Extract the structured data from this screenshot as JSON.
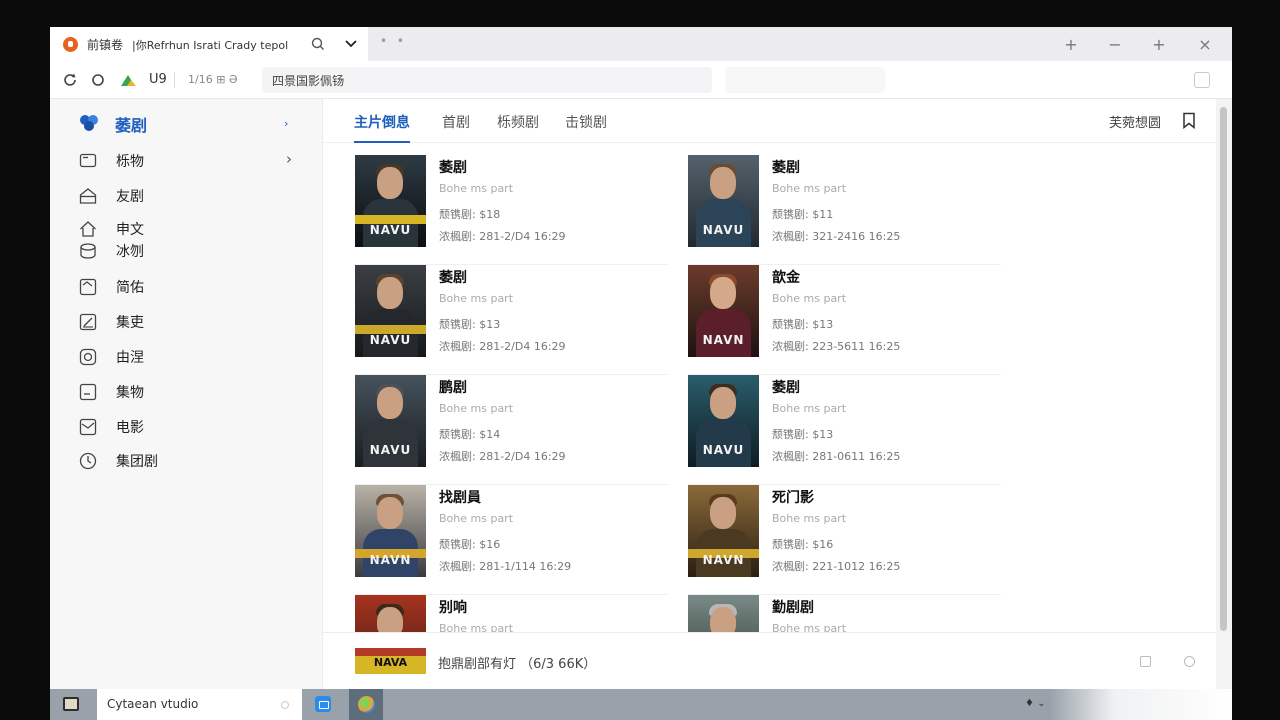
{
  "window": {
    "tab": {
      "title": "前镇卷",
      "subtitle": "|你Refrhun Israti  Crady tepol"
    },
    "controls": {
      "minimize_alt": "+",
      "minimize": "−",
      "maximize": "+",
      "close": "×"
    }
  },
  "addressbar": {
    "page_num": "U9",
    "zoom_text": "1/16  ⊞  Ə",
    "url": "四景国影佩钖"
  },
  "sidebar": {
    "header": {
      "label": "萎剧"
    },
    "items": [
      {
        "label": "栎物",
        "icon": "tv-icon",
        "has_chevron": true
      },
      {
        "label": "友剧",
        "icon": "house-icon"
      },
      {
        "label": "申文",
        "icon": "home-icon"
      },
      {
        "label": "冰刎",
        "icon": "cylinder-icon"
      },
      {
        "label": "简佑",
        "icon": "image-icon"
      },
      {
        "label": "集吏",
        "icon": "edit-icon"
      },
      {
        "label": "由涅",
        "icon": "camera-icon"
      },
      {
        "label": "集物",
        "icon": "minus-box-icon"
      },
      {
        "label": "电影",
        "icon": "picture-icon"
      },
      {
        "label": "集团剧",
        "icon": "clock-icon"
      }
    ]
  },
  "main": {
    "tabs": [
      {
        "label": "主片倒息",
        "active": true
      },
      {
        "label": "首剧"
      },
      {
        "label": "栎频剧"
      },
      {
        "label": "击锁剧"
      }
    ],
    "right_link": "芙菀想圆",
    "cards": [
      {
        "title": "萎剧",
        "sub": "Bohe ms part",
        "price": "颓镌剧: $18",
        "date": "浓楓剧: 281-2/D4 16:29",
        "poster_text": "NAVU"
      },
      {
        "title": "萎剧",
        "sub": "Bohe ms part",
        "price": "颓镌剧: $11",
        "date": "浓楓剧: 321-2416 16:25",
        "poster_text": "NAVU"
      },
      {
        "title": "萎剧",
        "sub": "Bohe ms part",
        "price": "颓镌剧: $13",
        "date": "浓楓剧: 281-2/D4 16:29",
        "poster_text": "NAVU"
      },
      {
        "title": "歆金",
        "sub": "Bohe ms part",
        "price": "颓镌剧: $13",
        "date": "浓楓剧: 223-5611 16:25",
        "poster_text": "NAVN"
      },
      {
        "title": "鹏剧",
        "sub": "Bohe ms part",
        "price": "颓镌剧: $14",
        "date": "浓楓剧: 281-2/D4 16:29",
        "poster_text": "NAVU"
      },
      {
        "title": "萎剧",
        "sub": "Bohe ms part",
        "price": "颓镌剧: $13",
        "date": "浓楓剧: 281-0611 16:25",
        "poster_text": "NAVU"
      },
      {
        "title": "找剧員",
        "sub": "Bohe ms part",
        "price": "颓镌剧: $16",
        "date": "浓楓剧: 281-1/114 16:29",
        "poster_text": "NAVN"
      },
      {
        "title": "死门影",
        "sub": "Bohe ms part",
        "price": "颓镌剧: $16",
        "date": "浓楓剧: 221-1012 16:25",
        "poster_text": "NAVN"
      },
      {
        "title": "别响",
        "sub": "Bohe ms part",
        "price": "",
        "date": "",
        "poster_text": ""
      },
      {
        "title": "勤剧剧",
        "sub": "Bohe ms part",
        "price": "",
        "date": "",
        "poster_text": ""
      }
    ]
  },
  "player": {
    "thumb_text": "NAVA",
    "text": "抱鼎剧部有灯  （6/3 66K）"
  },
  "taskbar": {
    "search_text": "Cytaean vtudio",
    "tray": "♦ ⌄"
  }
}
